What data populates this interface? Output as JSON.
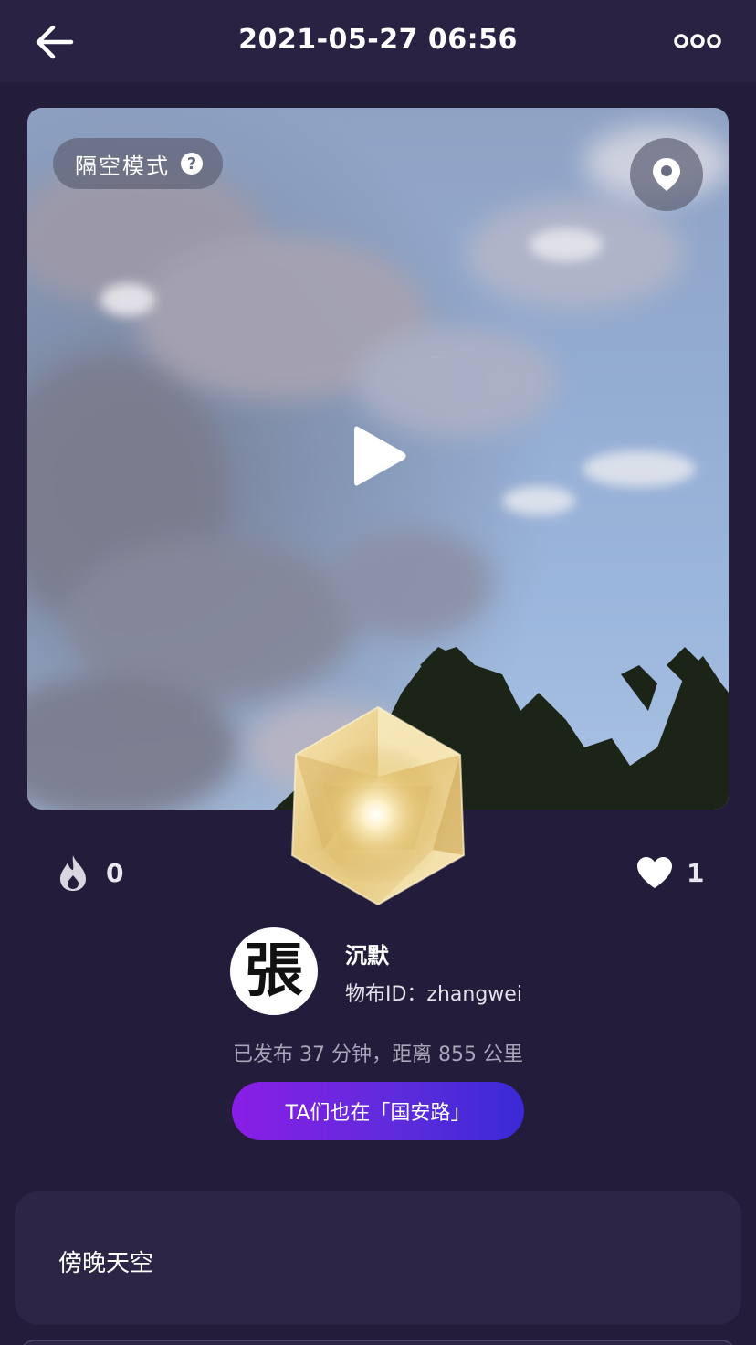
{
  "header": {
    "title": "2021-05-27 06:56",
    "back_icon": "arrow-left-icon",
    "more_icon": "more-dots-icon"
  },
  "media": {
    "mode_label": "隔空模式",
    "help_glyph": "?",
    "location_icon": "map-pin-icon",
    "play_icon": "play-icon"
  },
  "stats": {
    "heat_icon": "flame-icon",
    "heat_count": "0",
    "like_icon": "heart-icon",
    "like_count": "1"
  },
  "user": {
    "avatar_glyph": "張",
    "name": "沉默",
    "id_text": "物布ID：zhangwei"
  },
  "meta": "已发布 37 分钟，距离 855 公里",
  "cta_label": "TA们也在「国安路」",
  "description": "傍晚天空",
  "colors": {
    "background": "#231c3a",
    "header": "#2a2243",
    "card": "#2c2545",
    "cta_start": "#8a1ee6",
    "cta_end": "#3a2ad6"
  }
}
